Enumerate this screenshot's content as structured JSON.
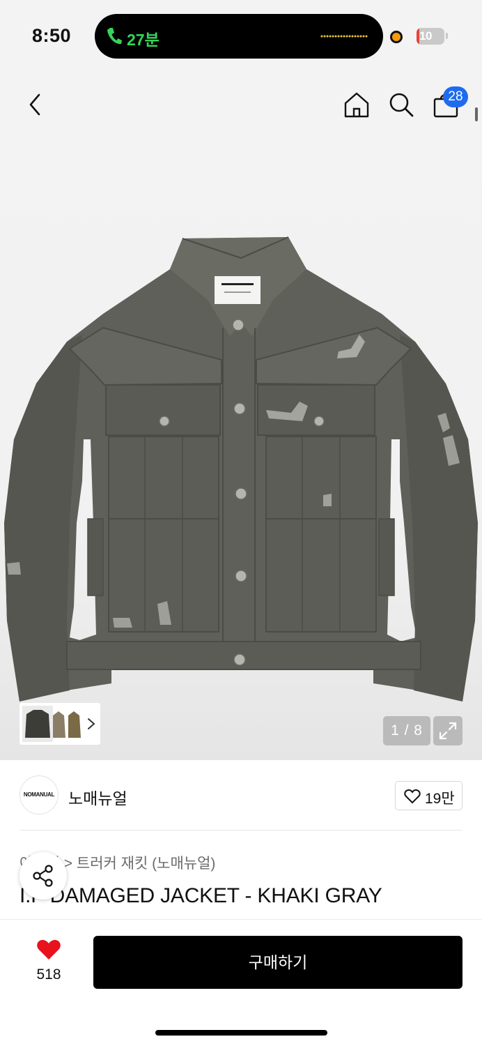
{
  "status_bar": {
    "time": "8:50",
    "call_duration": "27분",
    "battery_level": "10",
    "battery_percent": 10
  },
  "header": {
    "cart_count": "28",
    "icons": [
      "back-icon",
      "home-icon",
      "search-icon",
      "cart-icon"
    ]
  },
  "gallery": {
    "pager": "1 / 8",
    "label_brand_on_tag": "NOMANUAL"
  },
  "brand": {
    "logo_text": "NOMANUAL",
    "name": "노매뉴얼",
    "like_count": "19만"
  },
  "product": {
    "breadcrumb": "아우터 > 트러커 재킷 (노매뉴얼)",
    "title": "I.P DAMAGED JACKET - KHAKI GRAY"
  },
  "bottom_bar": {
    "fav_count": "518",
    "buy_label": "구매하기"
  },
  "colors": {
    "accent_badge": "#1e6bf0",
    "heart": "#e8121d",
    "call_green": "#35d45a",
    "jacket": "#5f605a"
  }
}
